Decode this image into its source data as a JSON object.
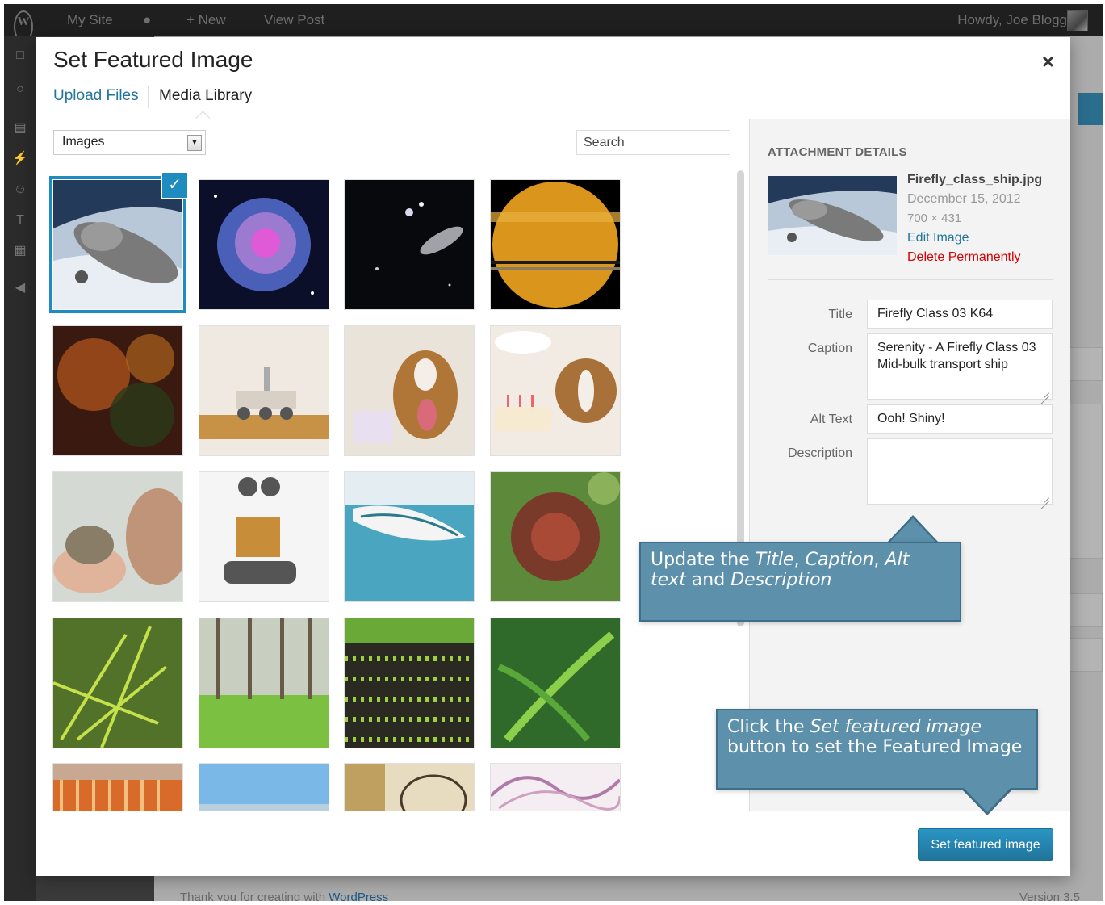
{
  "admin_bar": {
    "logo": "W",
    "site": "My Site",
    "comments_icon": "speech-bubble-icon",
    "new_label": "+ New",
    "view_post": "View Post",
    "howdy": "Howdy, Joe Blogg"
  },
  "admin_footer": {
    "thanks_prefix": "Thank you for creating with ",
    "thanks_link": "WordPress",
    "version": "Version 3.5"
  },
  "modal": {
    "title": "Set Featured Image",
    "close_label": "×",
    "tabs": {
      "upload": "Upload Files",
      "library": "Media Library"
    },
    "filter": {
      "selected": "Images"
    },
    "search": {
      "placeholder": "Search"
    },
    "thumbnails": [
      {
        "name": "serenity-ship",
        "selected": true
      },
      {
        "name": "helix-nebula"
      },
      {
        "name": "galaxy-starfield"
      },
      {
        "name": "saturn-rings"
      },
      {
        "name": "orange-nebula"
      },
      {
        "name": "mars-rover"
      },
      {
        "name": "boxer-dog-gifts"
      },
      {
        "name": "boxer-dog-birthday-cake"
      },
      {
        "name": "hedgehog-in-hand"
      },
      {
        "name": "wall-e-robot"
      },
      {
        "name": "rowboat-water"
      },
      {
        "name": "spiky-seed-pod"
      },
      {
        "name": "green-needles"
      },
      {
        "name": "pine-forest"
      },
      {
        "name": "seedling-field"
      },
      {
        "name": "green-fern"
      },
      {
        "name": "crayons"
      },
      {
        "name": "blue-sky"
      },
      {
        "name": "glasses-sepia"
      },
      {
        "name": "purple-smoke"
      }
    ],
    "check_icon": "✓",
    "button": "Set featured image"
  },
  "details": {
    "heading": "ATTACHMENT DETAILS",
    "filename": "Firefly_class_ship.jpg",
    "date": "December 15, 2012",
    "dimensions": "700 × 431",
    "edit": "Edit Image",
    "delete": "Delete Permanently",
    "fields": {
      "title_label": "Title",
      "title_value": "Firefly Class 03 K64",
      "caption_label": "Caption",
      "caption_value": "Serenity - A Firefly Class 03 Mid-bulk transport ship",
      "alt_label": "Alt Text",
      "alt_value": "Ooh! Shiny!",
      "desc_label": "Description",
      "desc_value": ""
    }
  },
  "callouts": {
    "fields": {
      "p1": "Update the ",
      "e1": "Title",
      "p2": ", ",
      "e2": "Caption",
      "p3": ", ",
      "e3": "Alt text",
      "p4": " and ",
      "e4": "Description"
    },
    "button": {
      "p1": "Click the ",
      "e1": "Set featured image",
      "p2": " button to set the Featured Image"
    }
  }
}
